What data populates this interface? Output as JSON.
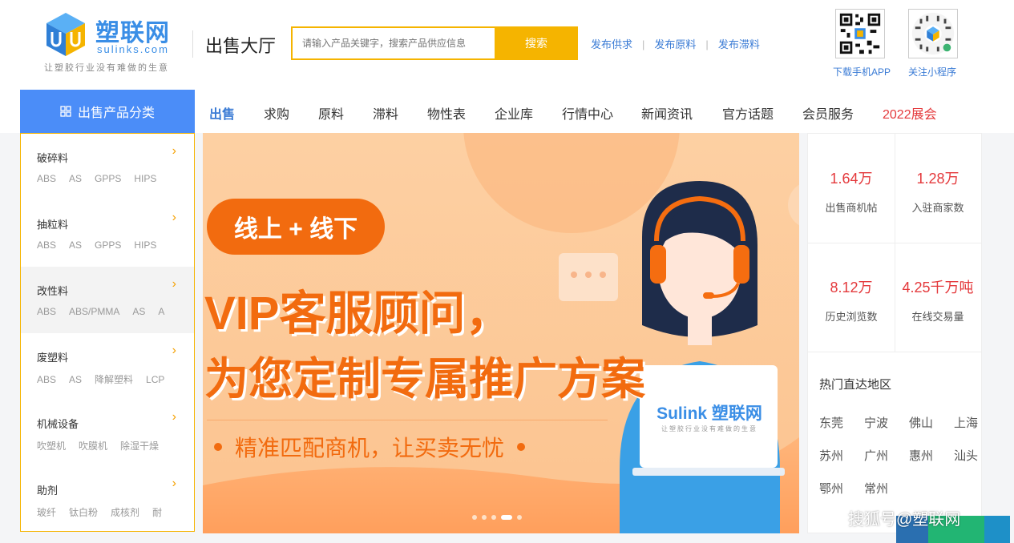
{
  "header": {
    "logo_name": "塑联网",
    "logo_domain": "sulinks.com",
    "logo_slogan": "让塑胶行业没有难做的生意",
    "hall_title": "出售大厅",
    "search": {
      "placeholder": "请输入产品关键字，搜索产品供应信息",
      "button": "搜索"
    },
    "pub_links": [
      "发布供求",
      "发布原料",
      "发布滞料"
    ],
    "qr_app_label": "下载手机APP",
    "qr_mini_label": "关注小程序"
  },
  "nav": {
    "category_tab": "出售产品分类",
    "items": [
      "出售",
      "求购",
      "原料",
      "滞料",
      "物性表",
      "企业库",
      "行情中心",
      "新闻资讯",
      "官方话题",
      "会员服务",
      "2022展会"
    ]
  },
  "sidebar": {
    "categories": [
      {
        "title": "破碎料",
        "subs": [
          "ABS",
          "AS",
          "GPPS",
          "HIPS"
        ]
      },
      {
        "title": "抽粒料",
        "subs": [
          "ABS",
          "AS",
          "GPPS",
          "HIPS"
        ]
      },
      {
        "title": "改性料",
        "subs": [
          "ABS",
          "ABS/PMMA",
          "AS",
          "A"
        ]
      },
      {
        "title": "废塑料",
        "subs": [
          "ABS",
          "AS",
          "降解塑料",
          "LCP"
        ]
      },
      {
        "title": "机械设备",
        "subs": [
          "吹塑机",
          "吹膜机",
          "除湿干燥"
        ]
      },
      {
        "title": "助剂",
        "subs": [
          "玻纤",
          "钛白粉",
          "成核剂",
          "耐"
        ]
      }
    ]
  },
  "banner": {
    "badge": "线上 + 线下",
    "headline1": "VIP客服顾问，",
    "headline2": "为您定制专属推广方案",
    "tagline": "精准匹配商机，让买卖无忧",
    "screen_brand": "Sulink 塑联网",
    "screen_slogan": "让塑胶行业没有难做的生意",
    "active_dot": 4,
    "dot_count": 5
  },
  "stats": {
    "cells": [
      {
        "value": "1.64万",
        "label": "出售商机帖"
      },
      {
        "value": "1.28万",
        "label": "入驻商家数"
      },
      {
        "value": "8.12万",
        "label": "历史浏览数"
      },
      {
        "value": "4.25千万吨",
        "label": "在线交易量"
      }
    ],
    "region_title": "热门直达地区",
    "regions": [
      "东莞",
      "宁波",
      "佛山",
      "上海",
      "苏州",
      "广州",
      "惠州",
      "汕头",
      "鄂州",
      "常州"
    ]
  },
  "watermark": "搜狐号@塑联网",
  "colors": {
    "brand_blue": "#3a8ee6",
    "accent_yellow": "#f5b400",
    "nav_blue": "#4b8df8",
    "stat_red": "#e4393c",
    "banner_orange": "#f26b0f"
  }
}
